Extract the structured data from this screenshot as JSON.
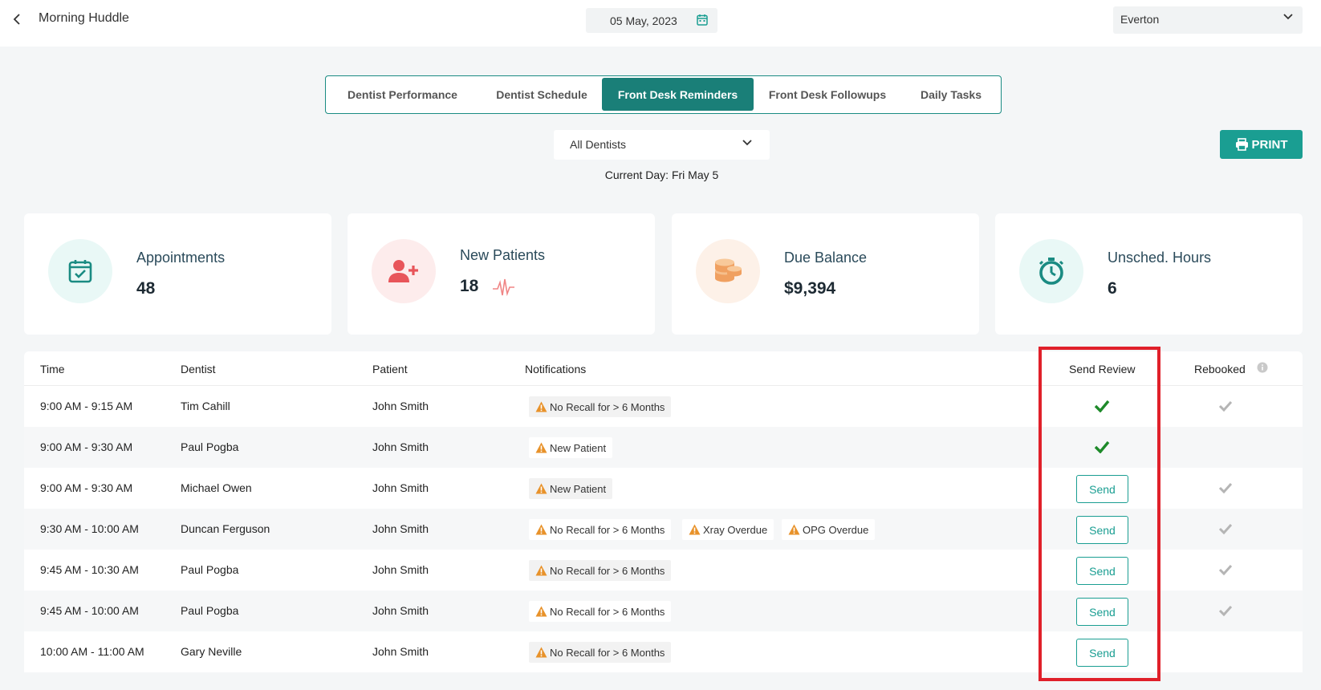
{
  "header": {
    "title": "Morning Huddle",
    "date": "05 May, 2023",
    "location": "Everton"
  },
  "tabs": [
    {
      "label": "Dentist Performance",
      "active": false
    },
    {
      "label": "Dentist Schedule",
      "active": false
    },
    {
      "label": "Front Desk Reminders",
      "active": true
    },
    {
      "label": "Front Desk Followups",
      "active": false
    },
    {
      "label": "Daily Tasks",
      "active": false
    }
  ],
  "filters": {
    "dentist": "All Dentists",
    "current_day": "Current Day: Fri May 5",
    "print_label": "PRINT"
  },
  "stats": [
    {
      "label": "Appointments",
      "value": "48",
      "icon": "calendar-check-icon",
      "color": "#1a8b82",
      "bg": "#e6f7f5"
    },
    {
      "label": "New Patients",
      "value": "18",
      "icon": "user-plus-icon",
      "color": "#e8555a",
      "bg": "#fdeaea"
    },
    {
      "label": "Due Balance",
      "value": "$9,394",
      "icon": "coins-icon",
      "color": "#f0a060",
      "bg": "#fdf0e6"
    },
    {
      "label": "Unsched. Hours",
      "value": "6",
      "icon": "stopwatch-icon",
      "color": "#1a8b82",
      "bg": "#e6f7f5"
    }
  ],
  "table": {
    "columns": [
      "Time",
      "Dentist",
      "Patient",
      "Notifications",
      "Send Review",
      "Rebooked"
    ],
    "send_label": "Send",
    "rows": [
      {
        "time": "9:00 AM - 9:15 AM",
        "dentist": "Tim Cahill",
        "patient": "John Smith",
        "notifications": [
          "No Recall for > 6 Months"
        ],
        "review_sent": true,
        "rebooked": true
      },
      {
        "time": "9:00 AM - 9:30 AM",
        "dentist": "Paul Pogba",
        "patient": "John Smith",
        "notifications": [
          "New Patient"
        ],
        "review_sent": true,
        "rebooked": false
      },
      {
        "time": "9:00 AM - 9:30 AM",
        "dentist": "Michael Owen",
        "patient": "John Smith",
        "notifications": [
          "New Patient"
        ],
        "review_sent": false,
        "rebooked": true
      },
      {
        "time": "9:30 AM - 10:00 AM",
        "dentist": "Duncan Ferguson",
        "patient": "John Smith",
        "notifications": [
          "No Recall for > 6 Months",
          "Xray Overdue",
          "OPG Overdue"
        ],
        "review_sent": false,
        "rebooked": true
      },
      {
        "time": "9:45 AM - 10:30 AM",
        "dentist": "Paul Pogba",
        "patient": "John Smith",
        "notifications": [
          "No Recall for > 6 Months"
        ],
        "review_sent": false,
        "rebooked": true
      },
      {
        "time": "9:45 AM - 10:00 AM",
        "dentist": "Paul Pogba",
        "patient": "John Smith",
        "notifications": [
          "No Recall for > 6 Months"
        ],
        "review_sent": false,
        "rebooked": true
      },
      {
        "time": "10:00 AM - 11:00 AM",
        "dentist": "Gary Neville",
        "patient": "John Smith",
        "notifications": [
          "No Recall for > 6 Months"
        ],
        "review_sent": false,
        "rebooked": false
      }
    ]
  },
  "colors": {
    "accent": "#1a8b82",
    "warning": "#e8922a",
    "sent_check": "#1e8a2a",
    "rebooked_check": "#b5b5b5",
    "highlight": "#e0202a"
  }
}
